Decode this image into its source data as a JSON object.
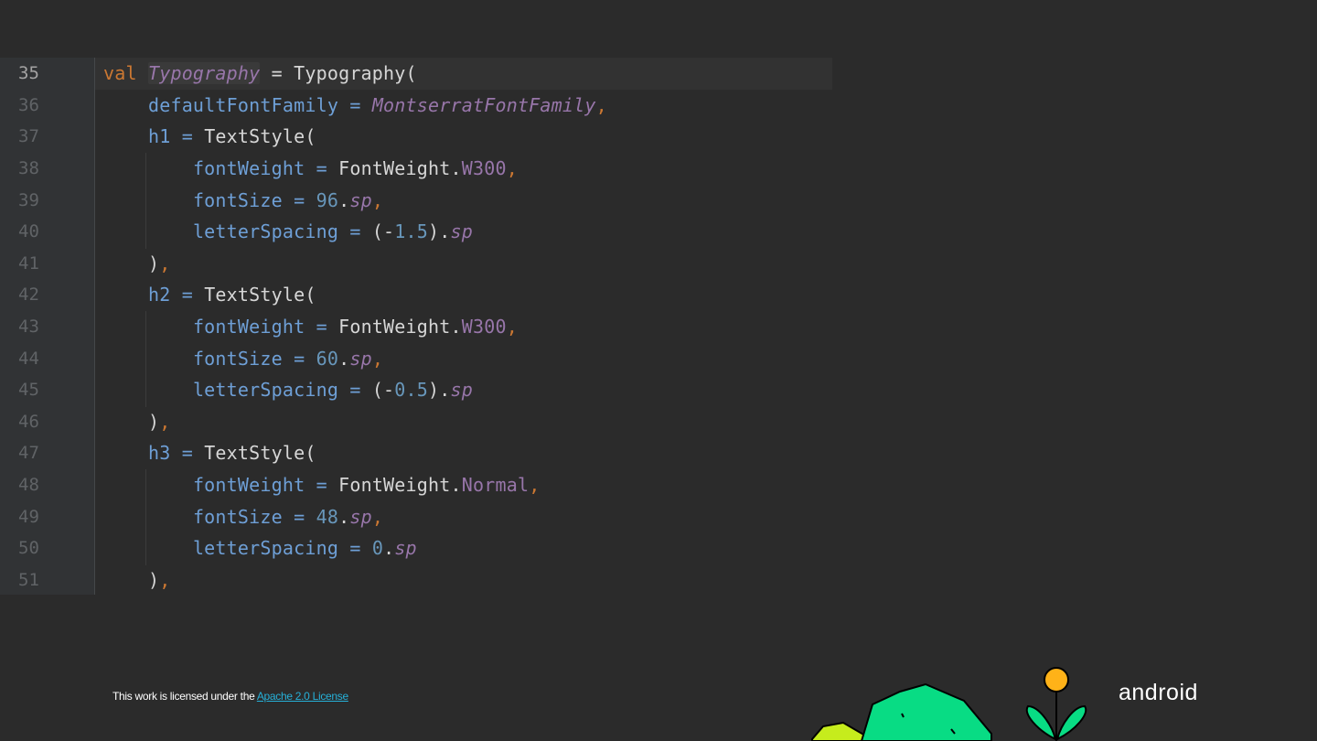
{
  "code": {
    "lines": [
      {
        "number": "35",
        "tokens": [
          {
            "t": "val ",
            "c": "kw"
          },
          {
            "t": "Typography",
            "c": "ital hl"
          },
          {
            "t": " = Typography(",
            "c": "plain"
          }
        ]
      },
      {
        "number": "36",
        "tokens": [
          {
            "t": "    ",
            "c": "plain"
          },
          {
            "t": "defaultFontFamily",
            "c": "param"
          },
          {
            "t": " = ",
            "c": "param"
          },
          {
            "t": "MontserratFontFamily",
            "c": "ital"
          },
          {
            "t": ",",
            "c": "comma"
          }
        ]
      },
      {
        "number": "37",
        "tokens": [
          {
            "t": "    ",
            "c": "plain"
          },
          {
            "t": "h1",
            "c": "param"
          },
          {
            "t": " = ",
            "c": "param"
          },
          {
            "t": "TextStyle(",
            "c": "plain"
          }
        ]
      },
      {
        "number": "38",
        "tokens": [
          {
            "t": "        ",
            "c": "plain"
          },
          {
            "t": "fontWeight",
            "c": "param"
          },
          {
            "t": " = ",
            "c": "param"
          },
          {
            "t": "FontWeight.",
            "c": "plain"
          },
          {
            "t": "W300",
            "c": "member"
          },
          {
            "t": ",",
            "c": "comma"
          }
        ]
      },
      {
        "number": "39",
        "tokens": [
          {
            "t": "        ",
            "c": "plain"
          },
          {
            "t": "fontSize",
            "c": "param"
          },
          {
            "t": " = ",
            "c": "param"
          },
          {
            "t": "96",
            "c": "num"
          },
          {
            "t": ".",
            "c": "plain"
          },
          {
            "t": "sp",
            "c": "ital"
          },
          {
            "t": ",",
            "c": "comma"
          }
        ]
      },
      {
        "number": "40",
        "tokens": [
          {
            "t": "        ",
            "c": "plain"
          },
          {
            "t": "letterSpacing",
            "c": "param"
          },
          {
            "t": " = ",
            "c": "param"
          },
          {
            "t": "(-",
            "c": "plain"
          },
          {
            "t": "1.5",
            "c": "num"
          },
          {
            "t": ").",
            "c": "plain"
          },
          {
            "t": "sp",
            "c": "ital"
          }
        ]
      },
      {
        "number": "41",
        "tokens": [
          {
            "t": "    ",
            "c": "plain"
          },
          {
            "t": ")",
            "c": "plain"
          },
          {
            "t": ",",
            "c": "comma"
          }
        ]
      },
      {
        "number": "42",
        "tokens": [
          {
            "t": "    ",
            "c": "plain"
          },
          {
            "t": "h2",
            "c": "param"
          },
          {
            "t": " = ",
            "c": "param"
          },
          {
            "t": "TextStyle(",
            "c": "plain"
          }
        ]
      },
      {
        "number": "43",
        "tokens": [
          {
            "t": "        ",
            "c": "plain"
          },
          {
            "t": "fontWeight",
            "c": "param"
          },
          {
            "t": " = ",
            "c": "param"
          },
          {
            "t": "FontWeight.",
            "c": "plain"
          },
          {
            "t": "W300",
            "c": "member"
          },
          {
            "t": ",",
            "c": "comma"
          }
        ]
      },
      {
        "number": "44",
        "tokens": [
          {
            "t": "        ",
            "c": "plain"
          },
          {
            "t": "fontSize",
            "c": "param"
          },
          {
            "t": " = ",
            "c": "param"
          },
          {
            "t": "60",
            "c": "num"
          },
          {
            "t": ".",
            "c": "plain"
          },
          {
            "t": "sp",
            "c": "ital"
          },
          {
            "t": ",",
            "c": "comma"
          }
        ]
      },
      {
        "number": "45",
        "tokens": [
          {
            "t": "        ",
            "c": "plain"
          },
          {
            "t": "letterSpacing",
            "c": "param"
          },
          {
            "t": " = ",
            "c": "param"
          },
          {
            "t": "(-",
            "c": "plain"
          },
          {
            "t": "0.5",
            "c": "num"
          },
          {
            "t": ").",
            "c": "plain"
          },
          {
            "t": "sp",
            "c": "ital"
          }
        ]
      },
      {
        "number": "46",
        "tokens": [
          {
            "t": "    ",
            "c": "plain"
          },
          {
            "t": ")",
            "c": "plain"
          },
          {
            "t": ",",
            "c": "comma"
          }
        ]
      },
      {
        "number": "47",
        "tokens": [
          {
            "t": "    ",
            "c": "plain"
          },
          {
            "t": "h3",
            "c": "param"
          },
          {
            "t": " = ",
            "c": "param"
          },
          {
            "t": "TextStyle(",
            "c": "plain"
          }
        ]
      },
      {
        "number": "48",
        "tokens": [
          {
            "t": "        ",
            "c": "plain"
          },
          {
            "t": "fontWeight",
            "c": "param"
          },
          {
            "t": " = ",
            "c": "param"
          },
          {
            "t": "FontWeight.",
            "c": "plain"
          },
          {
            "t": "Normal",
            "c": "member"
          },
          {
            "t": ",",
            "c": "comma"
          }
        ]
      },
      {
        "number": "49",
        "tokens": [
          {
            "t": "        ",
            "c": "plain"
          },
          {
            "t": "fontSize",
            "c": "param"
          },
          {
            "t": " = ",
            "c": "param"
          },
          {
            "t": "48",
            "c": "num"
          },
          {
            "t": ".",
            "c": "plain"
          },
          {
            "t": "sp",
            "c": "ital"
          },
          {
            "t": ",",
            "c": "comma"
          }
        ]
      },
      {
        "number": "50",
        "tokens": [
          {
            "t": "        ",
            "c": "plain"
          },
          {
            "t": "letterSpacing",
            "c": "param"
          },
          {
            "t": " = ",
            "c": "param"
          },
          {
            "t": "0",
            "c": "num"
          },
          {
            "t": ".",
            "c": "plain"
          },
          {
            "t": "sp",
            "c": "ital"
          }
        ]
      },
      {
        "number": "51",
        "tokens": [
          {
            "t": "    ",
            "c": "plain"
          },
          {
            "t": ")",
            "c": "plain"
          },
          {
            "t": ",",
            "c": "comma"
          }
        ]
      }
    ]
  },
  "footer": {
    "license_prefix": "This work is licensed under the ",
    "license_link": "Apache 2.0 License"
  },
  "brand": {
    "logo_text": "android"
  },
  "colors": {
    "background": "#2b2b2b",
    "keyword": "#cc7832",
    "parameter": "#6e9fd6",
    "italic_ref": "#9876aa",
    "number": "#6897bb",
    "link": "#26b0d8"
  },
  "icons": [
    "plant-illustration"
  ]
}
